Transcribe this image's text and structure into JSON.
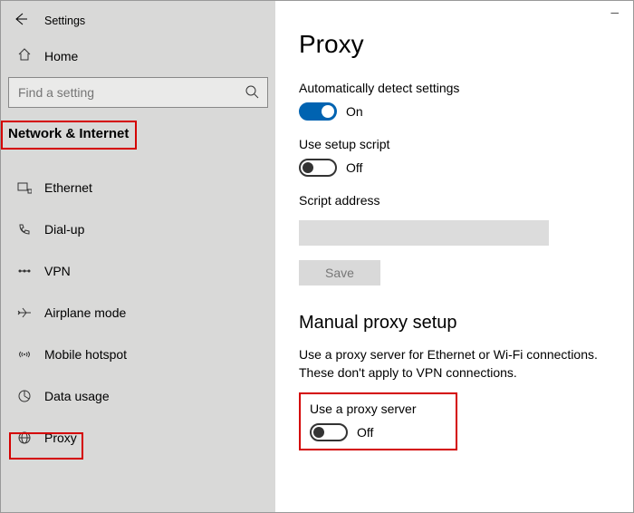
{
  "window_title": "Settings",
  "home_label": "Home",
  "search_placeholder": "Find a setting",
  "category_title": "Network & Internet",
  "nav": {
    "items": [
      {
        "label": "Ethernet"
      },
      {
        "label": "Dial-up"
      },
      {
        "label": "VPN"
      },
      {
        "label": "Airplane mode"
      },
      {
        "label": "Mobile hotspot"
      },
      {
        "label": "Data usage"
      },
      {
        "label": "Proxy"
      }
    ]
  },
  "main": {
    "title": "Proxy",
    "auto": {
      "detect_label": "Automatically detect settings",
      "detect_state": "On",
      "script_label": "Use setup script",
      "script_state": "Off",
      "addr_label": "Script address",
      "save": "Save"
    },
    "manual": {
      "heading": "Manual proxy setup",
      "desc": "Use a proxy server for Ethernet or Wi-Fi connections. These don't apply to VPN connections.",
      "use_label": "Use a proxy server",
      "use_state": "Off"
    }
  }
}
